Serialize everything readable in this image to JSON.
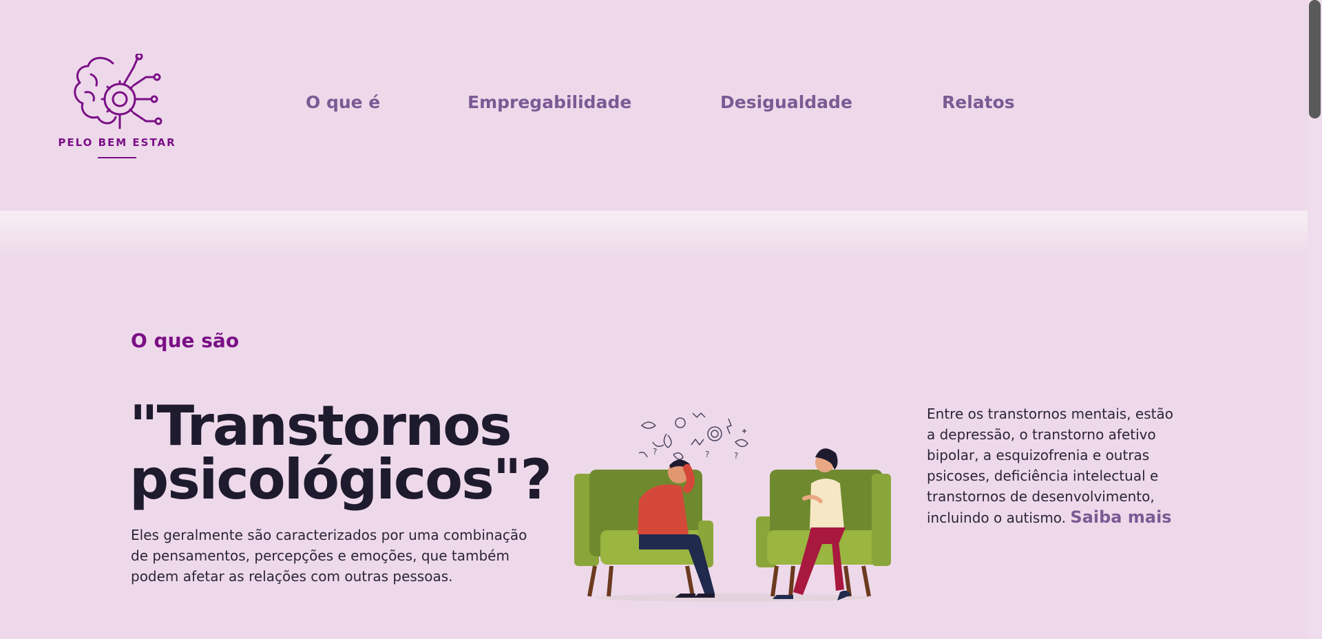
{
  "brand": {
    "name": "PELO BEM ESTAR",
    "color": "#7a0f86"
  },
  "nav": {
    "items": [
      {
        "label": "O que é"
      },
      {
        "label": "Empregabilidade"
      },
      {
        "label": "Desigualdade"
      },
      {
        "label": "Relatos"
      }
    ]
  },
  "hero": {
    "section_label": "O que são",
    "headline": "\"Transtornos psicológicos\"?",
    "intro": "Eles geralmente são caracterizados por uma combinação de pensamentos, percepções e emoções, que também podem afetar as relações com outras pessoas.",
    "side_text": "Entre os transtornos mentais, estão a depressão, o transtorno afetivo bipolar, a esquizofrenia e outras psicoses, deficiência intelectual e transtornos de desenvolvimento, incluindo o autismo.",
    "more_link": "Saiba mais"
  },
  "colors": {
    "background": "#eed9ea",
    "nav_text": "#7b5a94",
    "accent": "#7a0f86",
    "headline": "#1f1b2e",
    "chair": "#8aa63a"
  },
  "icons": {
    "logo": "brain-gear-circuit-icon",
    "illustration": "therapy-session-illustration"
  }
}
